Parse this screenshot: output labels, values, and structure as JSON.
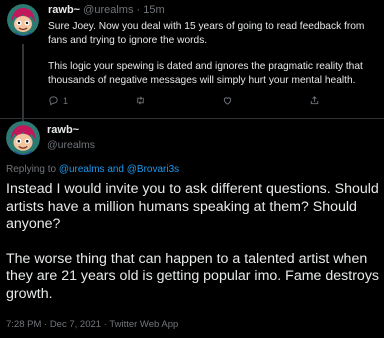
{
  "parent_tweet": {
    "display_name": "rawb~",
    "handle": "@urealms",
    "separator": "·",
    "time": "15m",
    "paragraphs": [
      "Sure Joey. Now you deal with 15 years of going to read feedback from fans and trying to ignore the words.",
      "This logic your spewing is dated and ignores the pragmatic reality that thousands of negative messages will simply hurt your mental health."
    ],
    "reply_count": "1",
    "icons": [
      "reply-icon",
      "retweet-icon",
      "like-icon",
      "share-icon"
    ]
  },
  "main_tweet": {
    "display_name": "rawb~",
    "handle": "@urealms",
    "replying_prefix": "Replying to",
    "replying_to_1": "@urealms",
    "replying_and": "and",
    "replying_to_2": "@Brovari3s",
    "paragraphs": [
      "Instead I would invite you to ask different questions. Should artists have a million humans speaking at them? Should anyone?",
      "The worse thing that can happen to a talented artist when they are 21 years old is getting popular imo. Fame destroys growth."
    ],
    "footer": "7:28 PM · Dec 7, 2021 · Twitter Web App"
  },
  "colors": {
    "background": "#000000",
    "text": "#e7e9ea",
    "muted": "#71767b",
    "link": "#1d9bf0",
    "divider": "#2f3336"
  }
}
